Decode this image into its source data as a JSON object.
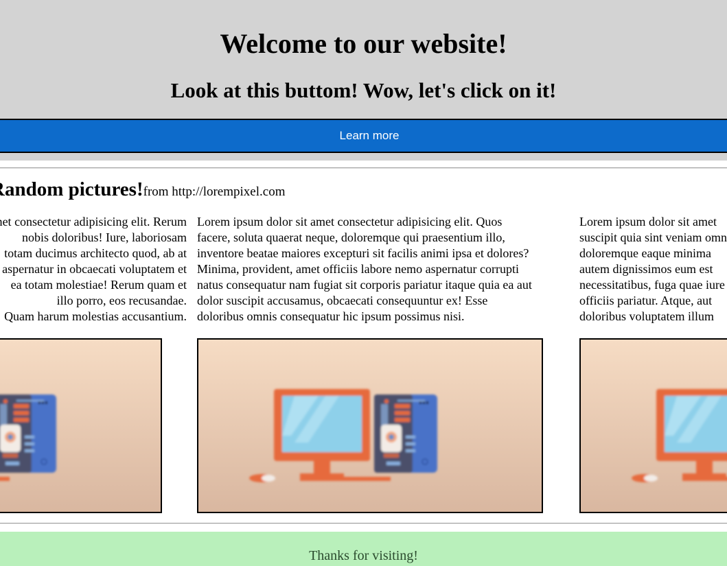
{
  "header": {
    "title": "Welcome to our website!",
    "subtitle": "Look at this buttom! Wow, let's click on it!",
    "button_label": "Learn more"
  },
  "section": {
    "title_bold": "Random pictures!",
    "title_small": "from http://lorempixel.com"
  },
  "columns": [
    {
      "lines": [
        "Lorem ipsum dolor sit amet consectetur adipisicing elit. Rerum",
        "nobis doloribus! Iure, laboriosam",
        "totam ducimus architecto quod, ab at",
        "aspernatur in obcaecati voluptatem et",
        "ea totam molestiae! Rerum quam et",
        "illo porro, eos recusandae.",
        "Quam harum molestias accusantium."
      ]
    },
    {
      "lines": [
        "Lorem ipsum dolor sit amet consectetur adipisicing elit. Quos",
        "facere, soluta quaerat neque, doloremque qui praesentium illo,",
        "inventore beatae maiores excepturi sit facilis animi ipsa et dolores?",
        "Minima, provident, amet officiis labore nemo aspernatur corrupti",
        "natus consequatur nam fugiat sit corporis pariatur itaque quia ea aut",
        "dolor suscipit accusamus, obcaecati consequuntur ex! Esse",
        "doloribus omnis consequatur hic ipsum possimus nisi."
      ]
    },
    {
      "lines": [
        "Lorem ipsum dolor sit amet",
        "suscipit quia sint veniam omnis",
        "doloremque eaque minima",
        "autem dignissimos eum est",
        "necessitatibus, fuga quae iure",
        "officiis pariatur. Atque, aut",
        "doloribus voluptatem illum"
      ]
    }
  ],
  "footer": {
    "text": "Thanks for visiting!"
  },
  "colors": {
    "header_bg": "#d3d3d3",
    "button_bg": "#0d6bcb",
    "footer_bg": "#b9f0bb"
  }
}
